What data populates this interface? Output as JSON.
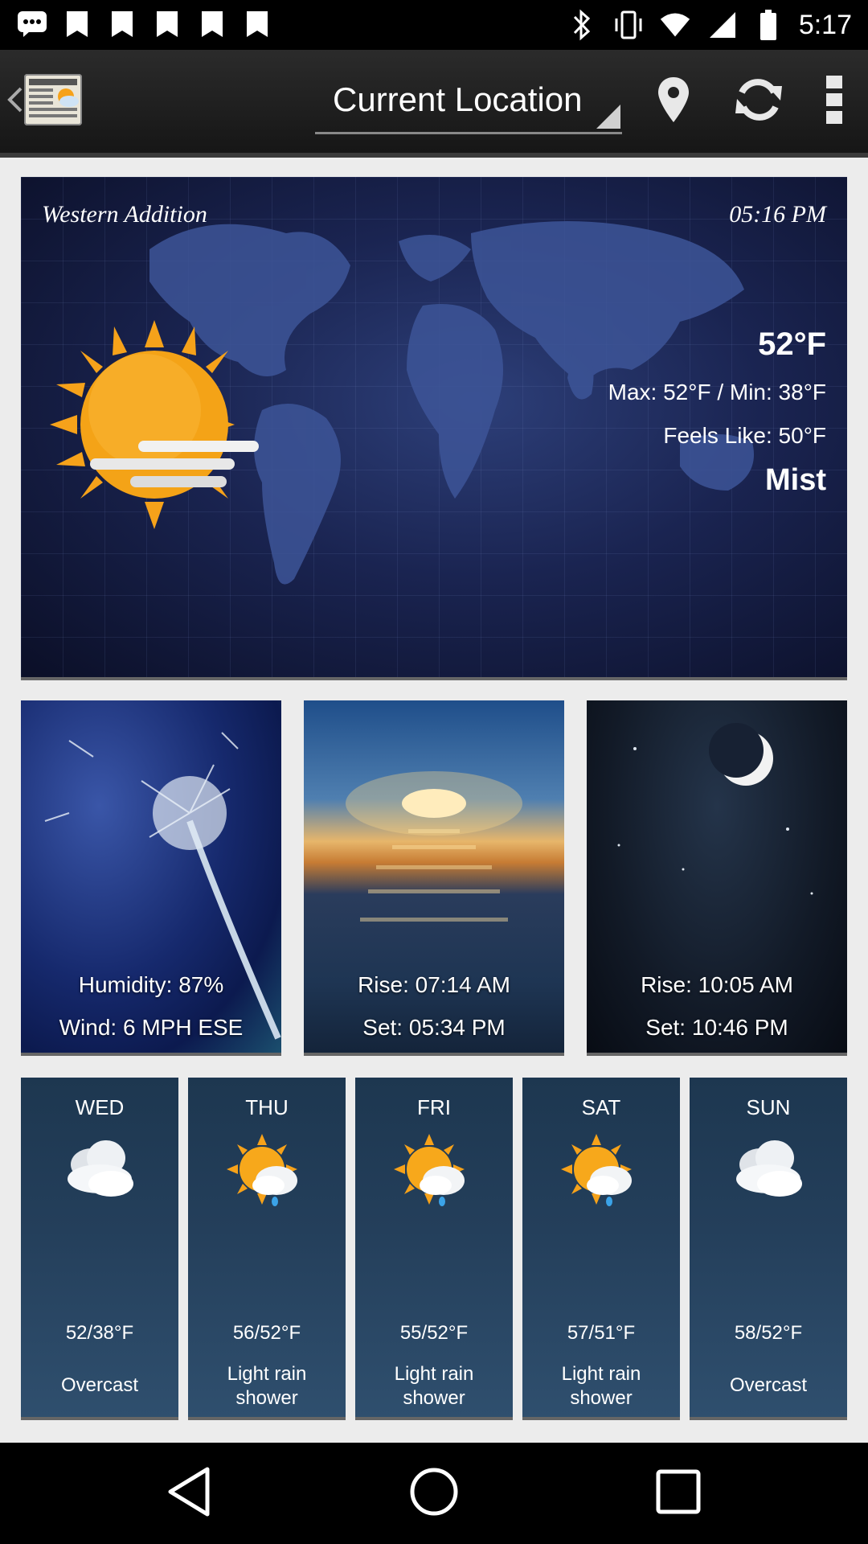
{
  "status_bar": {
    "time": "5:17",
    "left_icons": [
      "chat-bubble-icon",
      "photo-icon",
      "photo-icon",
      "photo-icon",
      "photo-icon",
      "photo-icon"
    ],
    "right_icons": [
      "bluetooth-icon",
      "vibrate-icon",
      "wifi-icon",
      "signal-icon",
      "battery-icon"
    ]
  },
  "app_bar": {
    "location_label": "Current Location",
    "actions": [
      "location-pin-icon",
      "refresh-icon",
      "overflow-menu-icon"
    ]
  },
  "current": {
    "location": "Western Addition",
    "time": "05:16 PM",
    "temperature": "52°F",
    "max_min": "Max: 52°F / Min: 38°F",
    "feels_like": "Feels Like: 50°F",
    "condition": "Mist",
    "icon": "sun-fog-icon"
  },
  "tiles": {
    "humidity": {
      "line1": "Humidity: 87%",
      "line2": "Wind: 6 MPH ESE"
    },
    "sun": {
      "line1": "Rise: 07:14 AM",
      "line2": "Set: 05:34 PM"
    },
    "moon": {
      "line1": "Rise: 10:05 AM",
      "line2": "Set: 10:46 PM"
    }
  },
  "forecast": [
    {
      "day": "WED",
      "temps": "52/38°F",
      "desc": "Overcast",
      "icon": "cloud-icon"
    },
    {
      "day": "THU",
      "temps": "56/52°F",
      "desc": "Light rain shower",
      "icon": "sun-rain-icon"
    },
    {
      "day": "FRI",
      "temps": "55/52°F",
      "desc": "Light rain shower",
      "icon": "sun-rain-icon"
    },
    {
      "day": "SAT",
      "temps": "57/51°F",
      "desc": "Light rain shower",
      "icon": "sun-rain-icon"
    },
    {
      "day": "SUN",
      "temps": "58/52°F",
      "desc": "Overcast",
      "icon": "cloud-icon"
    }
  ],
  "nav_bar": [
    "back-icon",
    "home-icon",
    "recents-icon"
  ],
  "colors": {
    "accent_sun": "#f6a21a",
    "appbar_bg": "#1c1c1c",
    "forecast_bg": "#243f5b"
  }
}
